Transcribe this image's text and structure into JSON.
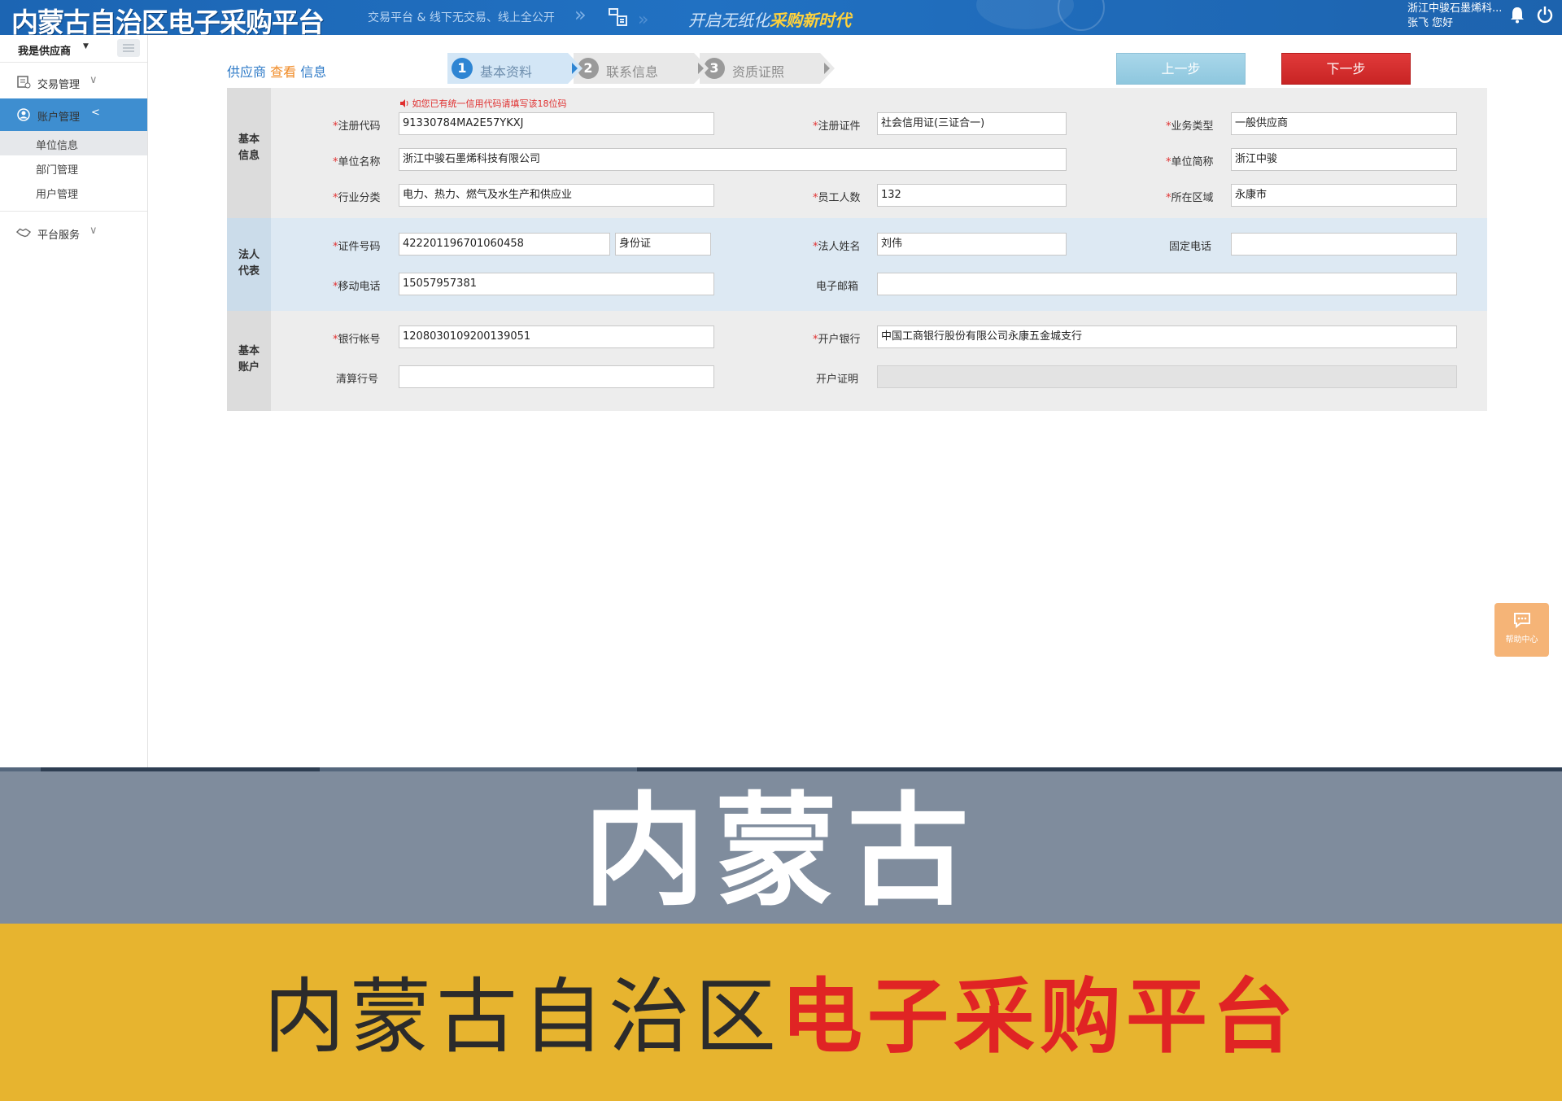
{
  "topbar": {
    "logo": "内蒙古自治区电子采购平台",
    "slogan1": "交易平台 & 线下无交易、线上全公开",
    "slogan2_prefix": "开启无纸化",
    "slogan2_highlight": "采购新时代",
    "company": "浙江中骏石墨烯科...",
    "greeting": "张飞  您好"
  },
  "sidebar": {
    "role": "我是供应商",
    "items": [
      {
        "label": "交易管理",
        "icon": "transaction-icon",
        "arrow": "∨"
      },
      {
        "label": "账户管理",
        "icon": "account-icon",
        "arrow": "<"
      },
      {
        "label": "平台服务",
        "icon": "handshake-icon",
        "arrow": "∨"
      }
    ],
    "sub_items": [
      "单位信息",
      "部门管理",
      "用户管理"
    ]
  },
  "crumb": {
    "part1": "供应商",
    "part2": "查看",
    "part3": "信息"
  },
  "steps": [
    {
      "num": "1",
      "label": "基本资料"
    },
    {
      "num": "2",
      "label": "联系信息"
    },
    {
      "num": "3",
      "label": "资质证照"
    }
  ],
  "buttons": {
    "prev": "上一步",
    "next": "下一步"
  },
  "form": {
    "hint": "如您已有统一信用代码请填写该18位码",
    "sections": {
      "basic": "基本信息",
      "legal": "法人代表",
      "bank": "基本账户"
    },
    "required_mark": "*",
    "fields": {
      "reg_code": {
        "label": "注册代码",
        "value": "91330784MA2E57YKXJ"
      },
      "reg_cert": {
        "label": "注册证件",
        "value": "社会信用证(三证合一)"
      },
      "biz_type": {
        "label": "业务类型",
        "value": "一般供应商"
      },
      "unit_name": {
        "label": "单位名称",
        "value": "浙江中骏石墨烯科技有限公司"
      },
      "unit_short": {
        "label": "单位简称",
        "value": "浙江中骏"
      },
      "industry": {
        "label": "行业分类",
        "value": "电力、热力、燃气及水生产和供应业"
      },
      "staff": {
        "label": "员工人数",
        "value": "132"
      },
      "region": {
        "label": "所在区域",
        "value": "永康市"
      },
      "id_no": {
        "label": "证件号码",
        "value": "422201196701060458"
      },
      "id_type": {
        "value": "身份证"
      },
      "legal_name": {
        "label": "法人姓名",
        "value": "刘伟"
      },
      "landline": {
        "label": "固定电话",
        "value": ""
      },
      "mobile": {
        "label": "移动电话",
        "value": "15057957381"
      },
      "email": {
        "label": "电子邮箱",
        "value": ""
      },
      "bank_no": {
        "label": "银行帐号",
        "value": "1208030109200139051"
      },
      "bank_name": {
        "label": "开户银行",
        "value": "中国工商银行股份有限公司永康五金城支行"
      },
      "clearing_no": {
        "label": "清算行号",
        "value": ""
      },
      "bank_cert": {
        "label": "开户证明",
        "value": ""
      }
    }
  },
  "help": {
    "label": "帮助中心"
  },
  "banner": {
    "title": "内蒙古",
    "subtitle_dark": "内蒙古自治区",
    "subtitle_red": "电子采购平台"
  },
  "colors": {
    "primary_blue": "#2171c2",
    "next_red": "#d32f2f",
    "prev_lightblue": "#9ccfe4",
    "banner_grey": "#7f8c9d",
    "banner_yellow": "#e7b42f",
    "accent_orange": "#f08a24"
  }
}
